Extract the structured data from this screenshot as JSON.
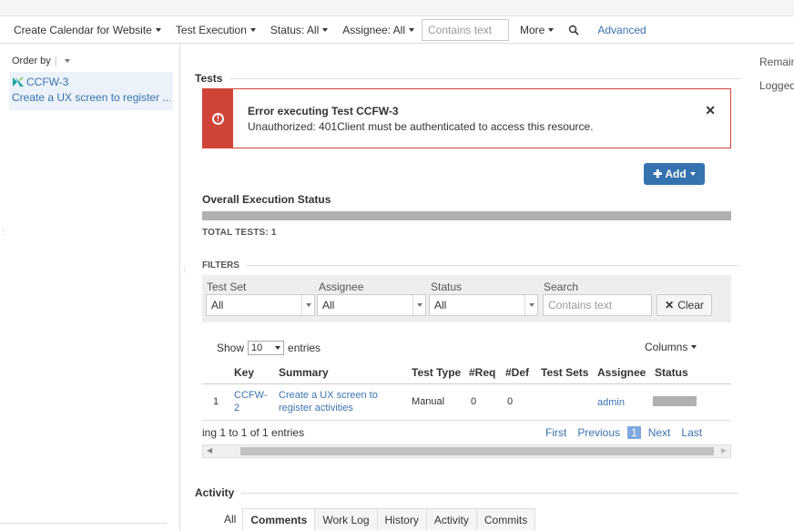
{
  "filterbar": {
    "project": "Create Calendar for Website",
    "type": "Test Execution",
    "status": "Status: All",
    "assignee": "Assignee: All",
    "search_placeholder": "Contains text",
    "more": "More",
    "advanced": "Advanced"
  },
  "leftpane": {
    "order_by": "Order by",
    "issue": {
      "key": "CCFW-3",
      "summary": "Create a UX screen to register ..."
    }
  },
  "main": {
    "tests_heading": "Tests",
    "error": {
      "title": "Error executing Test CCFW-3",
      "message": "Unauthorized: 401Client must be authenticated to access this resource.",
      "close": "✕"
    },
    "add_button": "Add",
    "overall_heading": "Overall Execution Status",
    "total_tests": "TOTAL TESTS: 1",
    "filters_heading": "FILTERS",
    "filters": {
      "test_set_label": "Test Set",
      "test_set_value": "All",
      "assignee_label": "Assignee",
      "assignee_value": "All",
      "status_label": "Status",
      "status_value": "All",
      "search_label": "Search",
      "search_placeholder": "Contains text",
      "clear": "Clear"
    },
    "table": {
      "show": "Show",
      "entries_value": "10",
      "entries": "entries",
      "columns": "Columns",
      "headers": [
        "Key",
        "Summary",
        "Test Type",
        "#Req",
        "#Def",
        "Test Sets",
        "Assignee",
        "Status"
      ],
      "rows": [
        {
          "index": "1",
          "key_line1": "CCFW-",
          "key_line2": "2",
          "summary_line1": "Create a UX screen to",
          "summary_line2": "register activities",
          "type": "Manual",
          "req": "0",
          "def": "0",
          "sets": "",
          "assignee": "admin"
        }
      ],
      "info": "ing 1 to 1 of 1 entries",
      "pager": {
        "first": "First",
        "previous": "Previous",
        "current": "1",
        "next": "Next",
        "last": "Last"
      }
    },
    "activity_heading": "Activity",
    "activity_tabs": [
      "All",
      "Comments",
      "Work Log",
      "History",
      "Activity",
      "Commits"
    ]
  },
  "rightpane": {
    "remaining": "Remaining",
    "logged": "Logged"
  },
  "colors": {
    "error": "#d04437",
    "link": "#3b73af",
    "primary": "#3572b0"
  }
}
